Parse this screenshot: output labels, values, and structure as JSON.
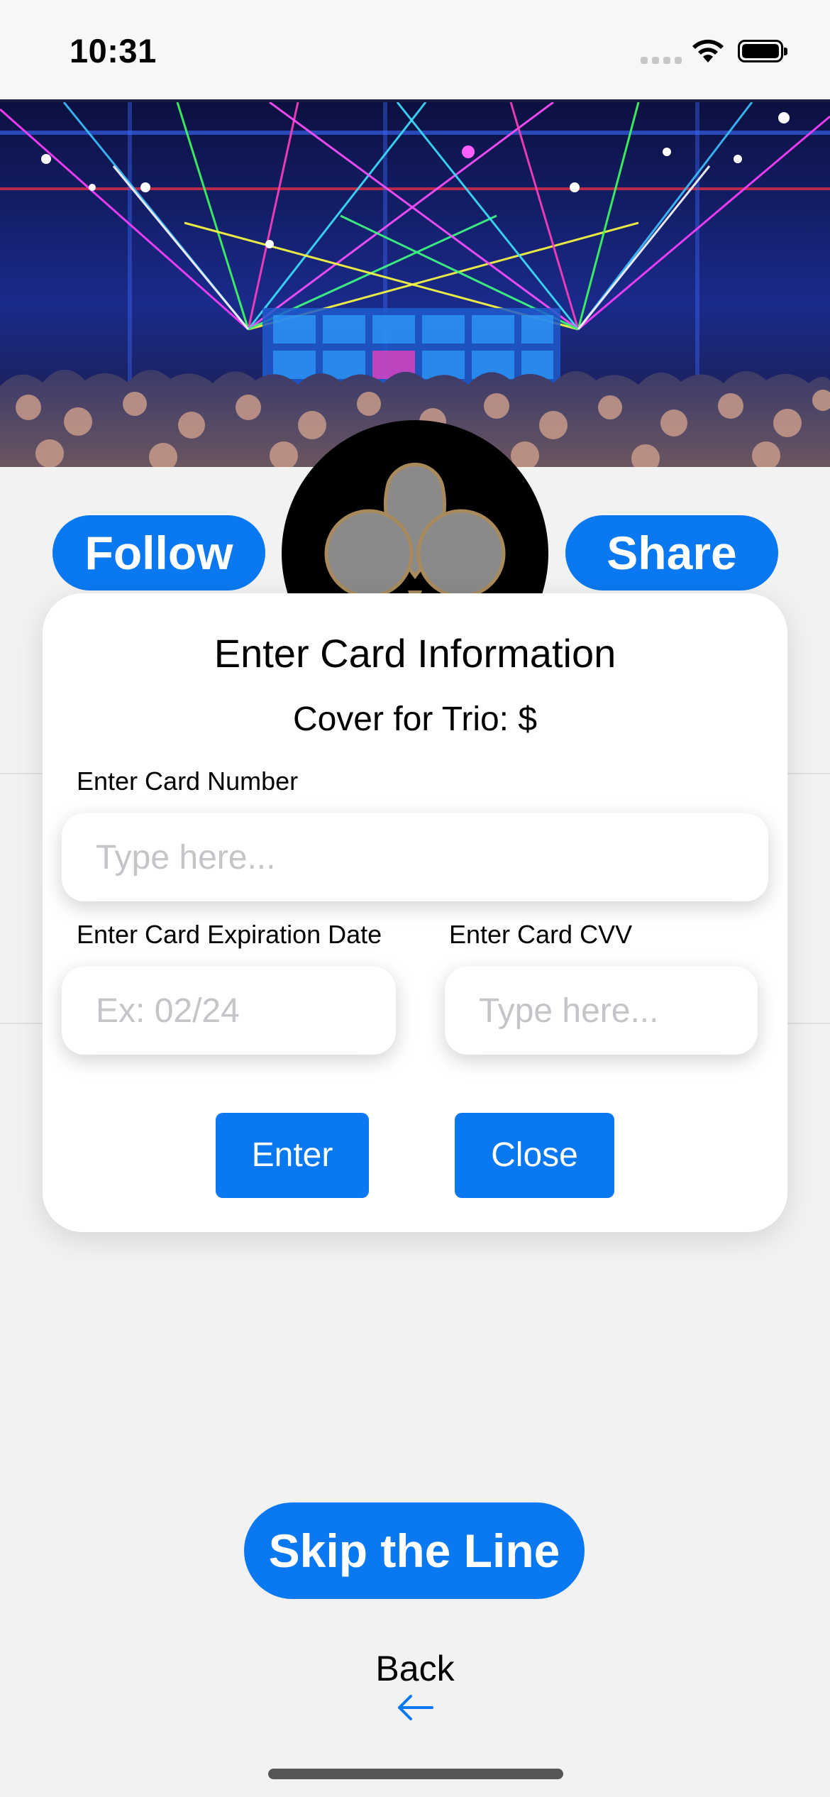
{
  "status_bar": {
    "time": "10:31",
    "icons": [
      "cellular-signal-icon",
      "wifi-icon",
      "battery-icon"
    ]
  },
  "venue": {
    "hero_image": "nightclub-laser-photo",
    "logo": "club-trefoil-logo"
  },
  "actions": {
    "follow_label": "Follow",
    "share_label": "Share"
  },
  "card_modal": {
    "title": "Enter Card Information",
    "cover_text": "Cover for Trio: $",
    "card_number": {
      "label": "Enter Card Number",
      "placeholder": "Type here...",
      "value": ""
    },
    "expiration": {
      "label": "Enter Card Expiration Date",
      "placeholder": "Ex: 02/24",
      "value": ""
    },
    "cvv": {
      "label": "Enter Card CVV",
      "placeholder": "Type here...",
      "value": ""
    },
    "enter_label": "Enter",
    "close_label": "Close"
  },
  "skip_label": "Skip the Line",
  "back_label": "Back",
  "colors": {
    "accent": "#0a78f0",
    "background": "#f2f2f2",
    "modal": "#ffffff",
    "logo_gold": "#a88a5c",
    "logo_grey": "#8a8a8a"
  }
}
